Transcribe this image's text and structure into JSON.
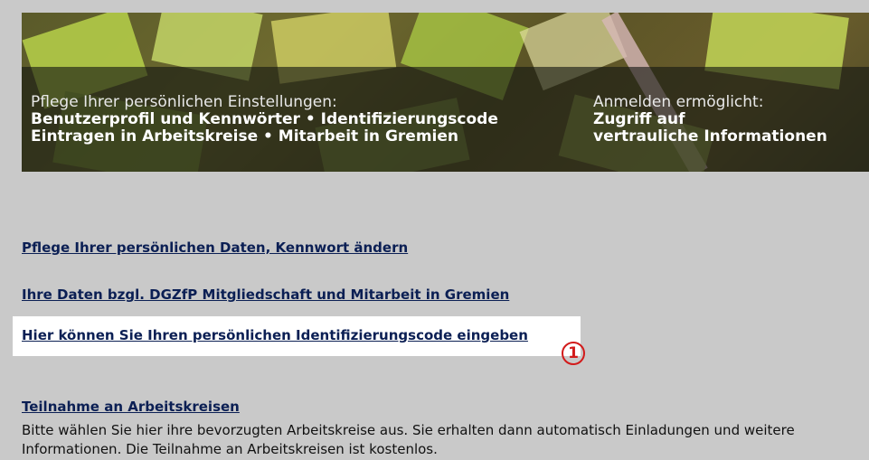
{
  "banner": {
    "left_line1": "Pflege Ihrer persönlichen Einstellungen:",
    "left_line2": "Benutzerprofil und Kennwörter • Identifizierungscode",
    "left_line3": "Eintragen in Arbeitskreise • Mitarbeit in Gremien",
    "right_line1": "Anmelden ermöglicht:",
    "right_line2": "Zugriff auf",
    "right_line3": "vertrauliche Informationen"
  },
  "links": {
    "personal_data": "Pflege Ihrer persönlichen Daten, Kennwort ändern",
    "membership": "Ihre Daten bzgl. DGZfP Mitgliedschaft und Mitarbeit in Gremien",
    "id_code": "Hier können Sie Ihren persönlichen Identifizierungscode eingeben",
    "working_groups": "Teilnahme an Arbeitskreisen"
  },
  "marker": {
    "label": "1",
    "color": "#d21b1b"
  },
  "working_groups_description": "Bitte wählen Sie hier ihre bevorzugten Arbeitskreise aus. Sie erhalten dann automatisch Einladungen und weitere Informationen. Die Teilnahme an Arbeitskreisen ist kostenlos.",
  "colors": {
    "link": "#0b1f54",
    "background": "#c9c9c9",
    "highlight": "#ffffff"
  }
}
